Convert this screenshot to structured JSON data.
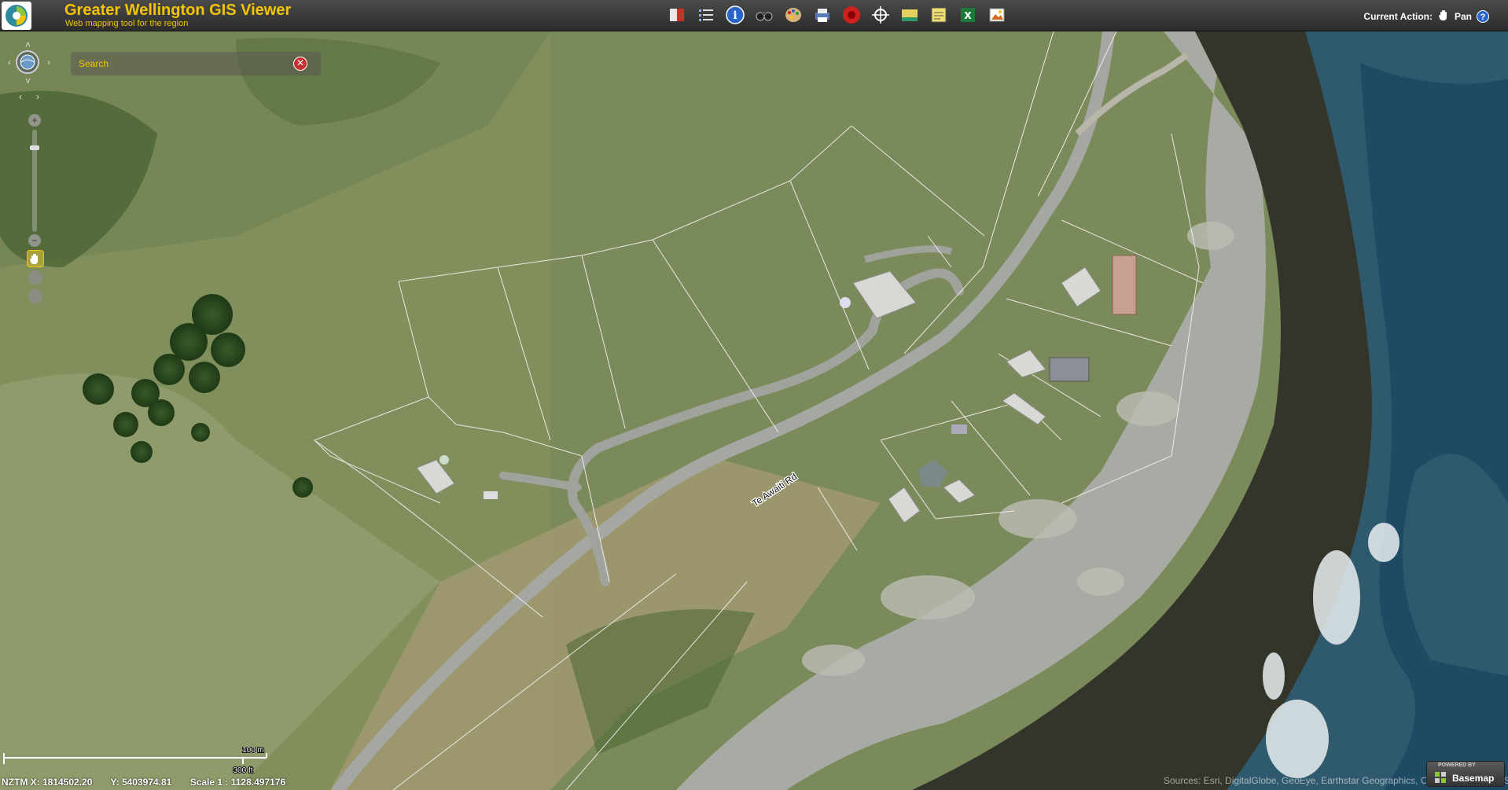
{
  "header": {
    "title": "Greater Wellington GIS Viewer",
    "subtitle": "Web mapping tool for the region",
    "current_action_label": "Current Action:",
    "current_action_value": "Pan",
    "help_label": "?"
  },
  "toolbar": {
    "tools": [
      {
        "icon": "book-icon"
      },
      {
        "icon": "layer-list-icon"
      },
      {
        "icon": "info-icon"
      },
      {
        "icon": "binoculars-icon"
      },
      {
        "icon": "palette-icon"
      },
      {
        "icon": "print-icon"
      },
      {
        "icon": "record-icon"
      },
      {
        "icon": "crosshair-icon"
      },
      {
        "icon": "measure-icon"
      },
      {
        "icon": "notes-icon"
      },
      {
        "icon": "excel-icon"
      },
      {
        "icon": "image-export-icon"
      }
    ]
  },
  "search": {
    "placeholder": "Search",
    "clear_symbol": "✕"
  },
  "map": {
    "road_label": "Te Awaiti Rd",
    "scale_metric": "100 m",
    "scale_imperial": "300 ft",
    "attribution": "Sources: Esri, DigitalGlobe, GeoEye, Earthstar Geographics, CNES/Airbus DS, USDA, USGS, AeroGRID, IGN, and the GIS User Community"
  },
  "status": {
    "x_label": "NZTM X: 1814502.20",
    "y_label": "Y: 5403974.81",
    "scale_label": "Scale 1 : 1128.497176"
  },
  "basemap": {
    "label": "Basemap",
    "powered_by": "POWERED BY"
  },
  "colors": {
    "accent": "#f5c400",
    "header_bg": "#333333",
    "sea": "#2f5a6e",
    "grass": "#7d8a5e"
  }
}
